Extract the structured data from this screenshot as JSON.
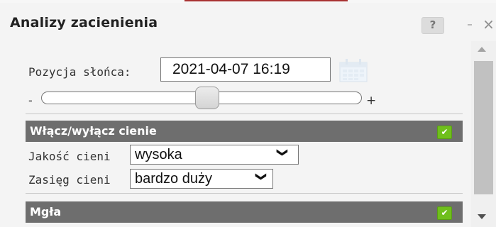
{
  "window": {
    "title": "Analizy zacienienia",
    "help_label": "?",
    "minimize_label": "–",
    "close_label": "×"
  },
  "sun": {
    "label": "Pozycja słońca:",
    "datetime_value": "2021-04-07 16:19",
    "slider_min_label": "-",
    "slider_max_label": "+",
    "slider_level": 0.52
  },
  "shadows": {
    "section_label": "Włącz/wyłącz cienie",
    "enabled": true,
    "quality_label": "Jakość cieni",
    "quality_value": "wysoka",
    "range_label": "Zasięg cieni",
    "range_value": "bardzo duży"
  },
  "fog": {
    "section_label": "Mgła",
    "enabled": true
  },
  "icons": {
    "calendar": "calendar-icon",
    "check": "check-icon",
    "chevron": "chevron-down-icon"
  },
  "colors": {
    "section_bg": "#6e6e6e",
    "checkbox": "#6fbf1c",
    "panel_bg": "#f4f4f4"
  }
}
